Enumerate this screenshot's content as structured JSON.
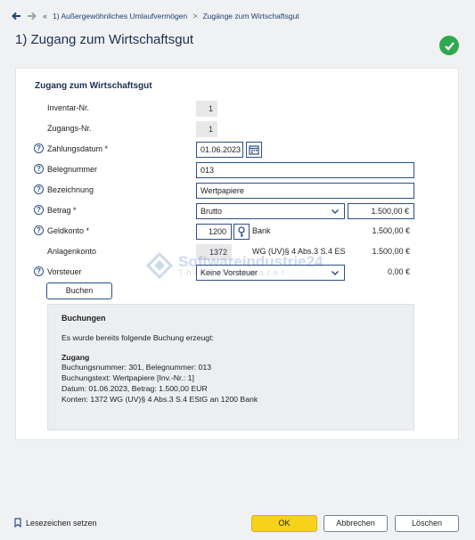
{
  "breadcrumb": {
    "separator_1": "«",
    "item_1": "1) Außergewöhnliches Umlaufvermögen",
    "separator_2": ">",
    "item_2": "Zugänge zum Wirtschaftsgut"
  },
  "page": {
    "title": "1) Zugang zum Wirtschaftsgut"
  },
  "form": {
    "section_title": "Zugang zum Wirtschaftsgut",
    "inventar_label": "Inventar-Nr.",
    "inventar_value": "1",
    "zugang_label": "Zugangs-Nr.",
    "zugang_value": "1",
    "zahlungsdatum_label": "Zahlungsdatum *",
    "zahlungsdatum_value": "01.06.2023",
    "beleg_label": "Belegnummer",
    "beleg_value": "013",
    "bezeichnung_label": "Bezeichnung",
    "bezeichnung_value": "Wertpapiere",
    "betrag_label": "Betrag *",
    "betrag_type": "Brutto",
    "betrag_value": "1.500,00 €",
    "geldkonto_label": "Geldkonto *",
    "geldkonto_value": "1200",
    "geldkonto_name": "Bank",
    "geldkonto_amount": "1.500,00 €",
    "anlagenkonto_label": "Anlagenkonto",
    "anlagenkonto_value": "1372",
    "anlagenkonto_name": "WG (UV)§ 4 Abs.3 S.4 ES",
    "anlagenkonto_amount": "1.500,00 €",
    "vorsteuer_label": "Vorsteuer",
    "vorsteuer_value": "Keine Vorsteuer",
    "vorsteuer_amount": "0,00 €",
    "help_glyph": "?",
    "buchen_label": "Buchen"
  },
  "watermark": {
    "text": "Softwareindustrie24",
    "subtext": "Think Software!"
  },
  "summary": {
    "title": "Buchungen",
    "intro": "Es wurde bereits folgende Buchung erzeugt:",
    "heading": "Zugang",
    "line_1": "Buchungsnummer: 301, Belegnummer: 013",
    "line_2": "Buchungstext: Wertpapiere [Inv.-Nr.: 1]",
    "line_3": "Datum: 01.06.2023, Betrag: 1.500,00 EUR",
    "line_4": "Konten: 1372 WG (UV)§ 4 Abs.3 S.4 EStG an 1200 Bank"
  },
  "footer": {
    "bookmark_label": "Lesezeichen setzen",
    "ok_label": "OK",
    "cancel_label": "Abbrechen",
    "delete_label": "Löschen"
  },
  "colors": {
    "accent": "#2d4f86",
    "ok_button": "#f6d21a",
    "success": "#2fa84f"
  }
}
